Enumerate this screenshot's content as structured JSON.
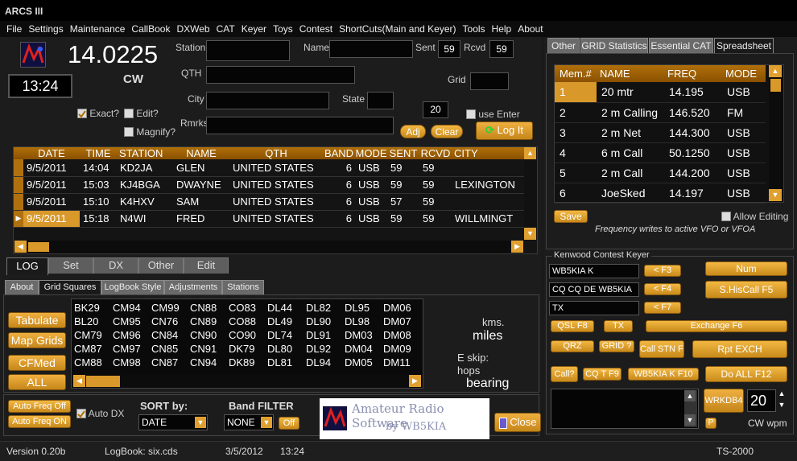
{
  "app": {
    "title": "ARCS III"
  },
  "menu": [
    "File",
    "Settings",
    "Maintenance",
    "CallBook",
    "DXWeb",
    "CAT",
    "Keyer",
    "Toys",
    "Contest",
    "ShortCuts(Main and Keyer)",
    "Tools",
    "Help",
    "About"
  ],
  "header": {
    "freq": "14.0225",
    "mode": "CW",
    "time": "13:24"
  },
  "fields": {
    "station_label": "Station",
    "name_label": "Name",
    "sent_label": "Sent",
    "sent_value": "59",
    "rcvd_label": "Rcvd",
    "rcvd_value": "59",
    "qth_label": "QTH",
    "grid_label": "Grid",
    "city_label": "City",
    "state_label": "State",
    "rmrks_label": "Rmrks",
    "num_value": "20"
  },
  "checks": {
    "exact": "Exact?",
    "edit": "Edit?",
    "magnify": "Magnify?",
    "use_enter": "use Enter"
  },
  "buttons": {
    "adj": "Adj",
    "clear": "Clear",
    "logit": "Log It"
  },
  "log": {
    "columns": [
      "DATE",
      "TIME",
      "STATION",
      "NAME",
      "QTH",
      "BAND",
      "MODE",
      "SENT",
      "RCVD",
      "CITY"
    ],
    "rows": [
      [
        "9/5/2011",
        "14:04",
        "KD2JA",
        "GLEN",
        "UNITED STATES",
        "6",
        "USB",
        "59",
        "59",
        ""
      ],
      [
        "9/5/2011",
        "15:03",
        "KJ4BGA",
        "DWAYNE",
        "UNITED STATES",
        "6",
        "USB",
        "59",
        "59",
        "LEXINGTON"
      ],
      [
        "9/5/2011",
        "15:10",
        "K4HXV",
        "SAM",
        "UNITED STATES",
        "6",
        "USB",
        "57",
        "59",
        ""
      ],
      [
        "9/5/2011",
        "15:18",
        "N4WI",
        "FRED",
        "UNITED STATES",
        "6",
        "USB",
        "59",
        "59",
        "WILLMINGT"
      ]
    ]
  },
  "main_tabs": [
    "LOG",
    "Set",
    "DX",
    "Other",
    "Edit"
  ],
  "sub_tabs": [
    "About",
    "Grid Squares",
    "LogBook Style",
    "Adjustments",
    "Stations"
  ],
  "grid_buttons": [
    "Tabulate",
    "Map Grids",
    "CFMed",
    "ALL"
  ],
  "grid_squares": [
    [
      "BK29",
      "CM94",
      "CM99",
      "CN88",
      "CO83",
      "DL44",
      "DL82",
      "DL95",
      "DM06"
    ],
    [
      "BL20",
      "CM95",
      "CN76",
      "CN89",
      "CO88",
      "DL49",
      "DL90",
      "DL98",
      "DM07"
    ],
    [
      "CM79",
      "CM96",
      "CN84",
      "CN90",
      "CO90",
      "DL74",
      "DL91",
      "DM03",
      "DM08"
    ],
    [
      "CM87",
      "CM97",
      "CN85",
      "CN91",
      "DK79",
      "DL80",
      "DL92",
      "DM04",
      "DM09"
    ],
    [
      "CM88",
      "CM98",
      "CN87",
      "CN94",
      "DK89",
      "DL81",
      "DL94",
      "DM05",
      "DM11"
    ]
  ],
  "grid_info": {
    "kms": "kms.",
    "miles": "miles",
    "eskip": "E skip:",
    "hops": "hops",
    "bearing": "bearing"
  },
  "bottom": {
    "auto_freq_off": "Auto Freq Off",
    "auto_freq_on": "Auto Freq ON",
    "auto_dx": "Auto DX",
    "sort_label": "SORT by:",
    "sort_value": "DATE",
    "band_label": "Band FILTER",
    "band_value": "NONE",
    "off": "Off",
    "close": "Close",
    "logo_line1": "Amateur Radio Software",
    "logo_line2": "by WB5KIA"
  },
  "right_tabs": [
    "Other",
    "GRID Statistics",
    "Essential CAT",
    "Spreadsheet"
  ],
  "spreadsheet": {
    "columns": [
      "Mem.#",
      "NAME",
      "FREQ",
      "MODE"
    ],
    "rows": [
      [
        "1",
        "20 mtr",
        "14.195",
        "USB"
      ],
      [
        "2",
        "2 m Calling",
        "146.520",
        "FM"
      ],
      [
        "3",
        "2 m Net",
        "144.300",
        "USB"
      ],
      [
        "4",
        "6 m Call",
        "50.1250",
        "USB"
      ],
      [
        "5",
        "2 m Call",
        "144.200",
        "USB"
      ],
      [
        "6",
        "JoeSked",
        "14.197",
        "USB"
      ]
    ],
    "save": "Save",
    "allow_editing": "Allow Editing",
    "note": "Frequency writes to active VFO or VFOA"
  },
  "keyer": {
    "title": "Kenwood Contest Keyer",
    "f3_text": "WB5KIA K",
    "f3_btn": "< F3",
    "f4_text": "CQ CQ DE WB5KIA",
    "f4_btn": "< F4",
    "f7_text": "TX",
    "f7_btn": "< F7",
    "num": "Num",
    "shiscall": "S.HisCall F5",
    "qsl": "QSL F8",
    "tx": "TX",
    "exchange": "Exchange F6",
    "qrz": "QRZ",
    "grid": "GRID ?",
    "callstn": "Call STN F11",
    "rptexch": "Rpt EXCH",
    "call": "Call?",
    "cqt": "CQ T  F9",
    "wb5kiak": "WB5KIA  K F10",
    "doall": "Do ALL F12",
    "wrkdb4": "WRKDB4",
    "wpm_value": "20",
    "wpm_label": "CW wpm",
    "p": "P"
  },
  "status": {
    "version": "Version 0.20b",
    "logbook": "LogBook: six.cds",
    "date": "3/5/2012",
    "time": "13:24",
    "rig": "TS-2000"
  }
}
